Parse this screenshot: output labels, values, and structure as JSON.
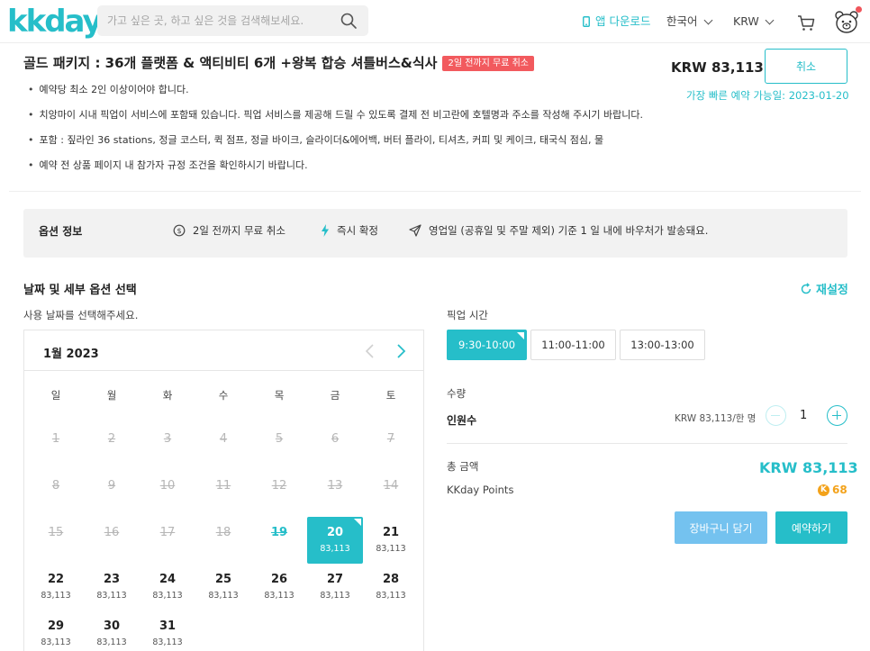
{
  "header": {
    "logo": "kkday",
    "search_placeholder": "가고 싶은 곳, 하고 싶은 것을 검색해보세요.",
    "app_download": "앱 다운로드",
    "language": "한국어",
    "currency": "KRW"
  },
  "package": {
    "title": "골드 패키지 : 36개 플랫폼 & 액티비티 6개 +왕복 합승 셔틀버스&식사",
    "badge": "2일 전까지 무료 취소",
    "price": "KRW 83,113",
    "cancel_label": "취소",
    "earliest": "가장 빠른 예약 가능일: 2023-01-20",
    "bullets": [
      "예약당 최소 2인 이상이어야 합니다.",
      "치앙마이 시내 픽업이 서비스에 포함돼 있습니다. 픽업 서비스를 제공해 드릴 수 있도록 결제 전 비고란에 호텔명과 주소를 작성해 주시기 바랍니다.",
      "포함 : 짚라인 36 stations, 정글 코스터, 퀵 점프, 정글 바이크, 슬라이더&에어백, 버터 플라이, 티셔츠, 커피 및 케이크, 태국식 점심, 물",
      "예약 전 상품 페이지 내 참가자 규정 조건을 확인하시기 바랍니다."
    ]
  },
  "options": {
    "label": "옵션 정보",
    "free_cancel": "2일 전까지 무료 취소",
    "instant": "즉시 확정",
    "voucher": "영업일 (공휴일 및 주말 제외) 기준 1 일 내에 바우처가 발송돼요."
  },
  "date": {
    "title": "날짜 및 세부 옵션 선택",
    "reset": "재설정",
    "subtitle": "사용 날짜를 선택해주세요."
  },
  "calendar": {
    "month": "1월 2023",
    "weekdays": [
      "일",
      "월",
      "화",
      "수",
      "목",
      "금",
      "토"
    ],
    "days": [
      {
        "d": "1",
        "p": "",
        "s": "past"
      },
      {
        "d": "2",
        "p": "",
        "s": "past"
      },
      {
        "d": "3",
        "p": "",
        "s": "past"
      },
      {
        "d": "4",
        "p": "",
        "s": "past"
      },
      {
        "d": "5",
        "p": "",
        "s": "past"
      },
      {
        "d": "6",
        "p": "",
        "s": "past"
      },
      {
        "d": "7",
        "p": "",
        "s": "past"
      },
      {
        "d": "8",
        "p": "",
        "s": "past"
      },
      {
        "d": "9",
        "p": "",
        "s": "past"
      },
      {
        "d": "10",
        "p": "",
        "s": "past"
      },
      {
        "d": "11",
        "p": "",
        "s": "past"
      },
      {
        "d": "12",
        "p": "",
        "s": "past"
      },
      {
        "d": "13",
        "p": "",
        "s": "past"
      },
      {
        "d": "14",
        "p": "",
        "s": "past"
      },
      {
        "d": "15",
        "p": "",
        "s": "past"
      },
      {
        "d": "16",
        "p": "",
        "s": "past"
      },
      {
        "d": "17",
        "p": "",
        "s": "past"
      },
      {
        "d": "18",
        "p": "",
        "s": "past"
      },
      {
        "d": "19",
        "p": "",
        "s": "strike-teal"
      },
      {
        "d": "20",
        "p": "83,113",
        "s": "sel"
      },
      {
        "d": "21",
        "p": "83,113",
        "s": ""
      },
      {
        "d": "22",
        "p": "83,113",
        "s": ""
      },
      {
        "d": "23",
        "p": "83,113",
        "s": ""
      },
      {
        "d": "24",
        "p": "83,113",
        "s": ""
      },
      {
        "d": "25",
        "p": "83,113",
        "s": ""
      },
      {
        "d": "26",
        "p": "83,113",
        "s": ""
      },
      {
        "d": "27",
        "p": "83,113",
        "s": ""
      },
      {
        "d": "28",
        "p": "83,113",
        "s": ""
      },
      {
        "d": "29",
        "p": "83,113",
        "s": ""
      },
      {
        "d": "30",
        "p": "83,113",
        "s": ""
      },
      {
        "d": "31",
        "p": "83,113",
        "s": ""
      }
    ]
  },
  "pickup": {
    "label": "픽업 시간",
    "times": [
      "9:30-10:00",
      "11:00-11:00",
      "13:00-13:00"
    ]
  },
  "quantity": {
    "label": "수량",
    "person_label": "인원수",
    "unit_price": "KRW 83,113/한 명",
    "value": "1"
  },
  "summary": {
    "total_label": "총 금액",
    "total_value": "KRW 83,113",
    "points_label": "KKday Points",
    "points_value": "68",
    "coin_symbol": "K",
    "cart_label": "장바구니 담기",
    "book_label": "예약하기"
  },
  "colors": {
    "brand": "#26bec9",
    "badge": "#f25a5e",
    "cart_button": "#74c2ef",
    "points": "#f3a21a"
  }
}
